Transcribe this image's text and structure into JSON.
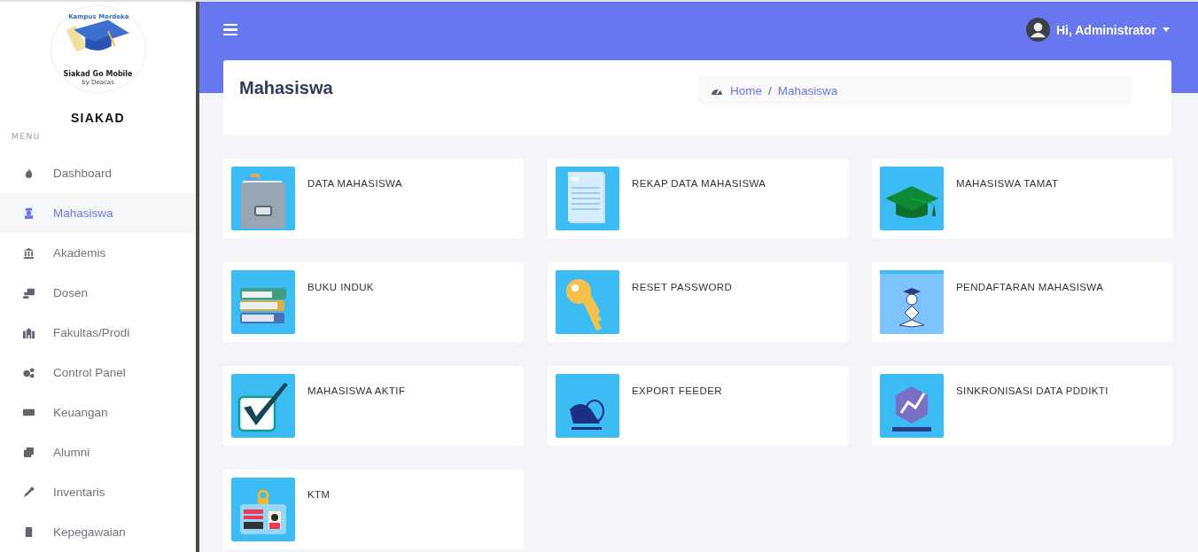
{
  "sidebar": {
    "logo": {
      "badge": "Kampus Merdeka",
      "name": "Siakad Go Mobile",
      "by": "by Deacas"
    },
    "title": "SIAKAD",
    "section": "MENU",
    "items": [
      {
        "label": "Dashboard",
        "selected": false
      },
      {
        "label": "Mahasiswa",
        "selected": true
      },
      {
        "label": "Akademis",
        "selected": false
      },
      {
        "label": "Dosen",
        "selected": false
      },
      {
        "label": "Fakultas/Prodi",
        "selected": false
      },
      {
        "label": "Control Panel",
        "selected": false
      },
      {
        "label": "Keuangan",
        "selected": false
      },
      {
        "label": "Alumni",
        "selected": false
      },
      {
        "label": "Inventaris",
        "selected": false
      },
      {
        "label": "Kepegawaian",
        "selected": false
      }
    ]
  },
  "header": {
    "user": "Hi, Administrator"
  },
  "page": {
    "title": "Mahasiswa",
    "breadcrumb": [
      "Home",
      "Mahasiswa"
    ],
    "breadcrumb_separator": "/"
  },
  "tiles": [
    {
      "label": "DATA MAHASISWA"
    },
    {
      "label": "REKAP DATA MAHASISWA"
    },
    {
      "label": "MAHASISWA TAMAT"
    },
    {
      "label": "BUKU INDUK"
    },
    {
      "label": "RESET PASSWORD"
    },
    {
      "label": "PENDAFTARAN MAHASISWA"
    },
    {
      "label": "MAHASISWA AKTIF"
    },
    {
      "label": "EXPORT FEEDER"
    },
    {
      "label": "SINKRONISASI DATA PDDIKTI"
    },
    {
      "label": "KTM"
    }
  ]
}
